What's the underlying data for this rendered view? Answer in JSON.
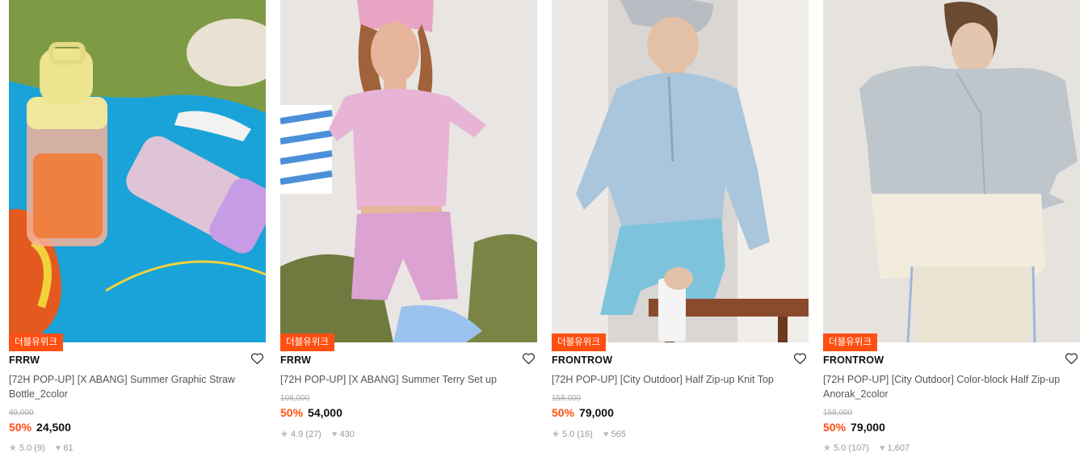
{
  "products": [
    {
      "badge": "더블유위크",
      "brand": "FRRW",
      "name": "[72H POP-UP] [X ABANG] Summer Graphic Straw Bottle_2color",
      "original_price": "49,000",
      "discount": "50%",
      "price": "24,500",
      "rating": "5.0 (9)",
      "likes": "61"
    },
    {
      "badge": "더블유위크",
      "brand": "FRRW",
      "name": "[72H POP-UP] [X ABANG] Summer Terry Set up",
      "original_price": "108,000",
      "discount": "50%",
      "price": "54,000",
      "rating": "4.9 (27)",
      "likes": "430"
    },
    {
      "badge": "더블유위크",
      "brand": "FRONTROW",
      "name": "[72H POP-UP] [City Outdoor] Half Zip-up Knit Top",
      "original_price": "158,000",
      "discount": "50%",
      "price": "79,000",
      "rating": "5.0 (16)",
      "likes": "565"
    },
    {
      "badge": "더블유위크",
      "brand": "FRONTROW",
      "name": "[72H POP-UP] [City Outdoor] Color-block Half Zip-up Anorak_2color",
      "original_price": "158,000",
      "discount": "50%",
      "price": "79,000",
      "rating": "5.0 (107)",
      "likes": "1,607"
    }
  ],
  "icons": {
    "wishlist": "heart-outline-icon",
    "rating": "star-icon",
    "likes": "heart-filled-icon"
  },
  "colors": {
    "badge_bg": "#ff4f12",
    "discount": "#ff4f12"
  }
}
